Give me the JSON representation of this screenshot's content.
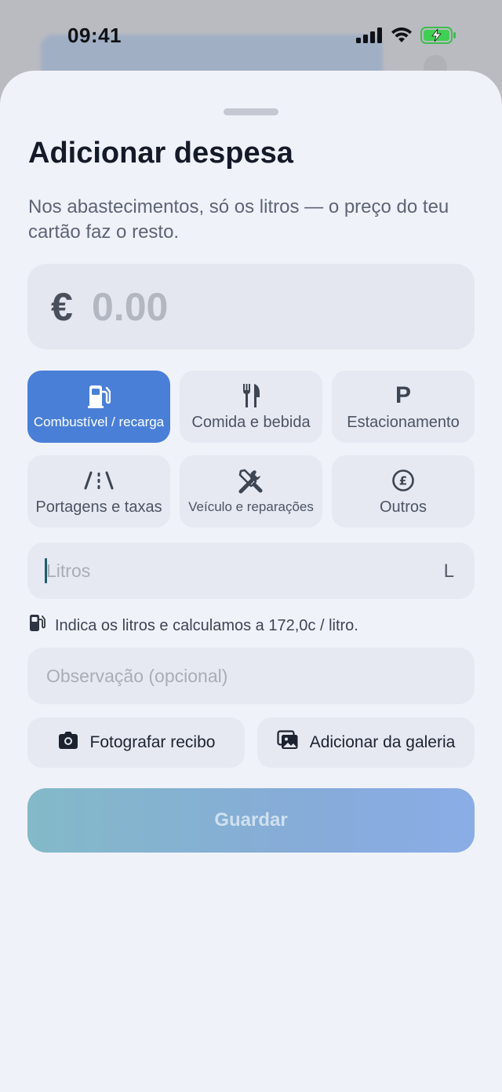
{
  "status": {
    "time": "09:41"
  },
  "sheet": {
    "title": "Adicionar despesa",
    "subtitle": "Nos abastecimentos, só os litros — o preço do teu cartão faz o resto."
  },
  "amount": {
    "currency": "€",
    "placeholder": "0.00"
  },
  "categories": [
    {
      "label": "Combustível / recarga",
      "icon": "fuel-pump-icon",
      "selected": true
    },
    {
      "label": "Comida e bebida",
      "icon": "fork-knife-icon",
      "selected": false
    },
    {
      "label": "Estacionamento",
      "icon": "parking-icon",
      "glyph": "P",
      "selected": false
    },
    {
      "label": "Portagens e taxas",
      "icon": "road-icon",
      "selected": false
    },
    {
      "label": "Veículo e reparações",
      "icon": "tools-icon",
      "selected": false
    },
    {
      "label": "Outros",
      "icon": "coin-icon",
      "selected": false
    }
  ],
  "liters": {
    "placeholder": "Litros",
    "unit": "L"
  },
  "hint": "Indica os litros e calculamos a 172,0c / litro.",
  "note": {
    "placeholder": "Observação (opcional)"
  },
  "actions": {
    "photo": "Fotografar recibo",
    "gallery": "Adicionar da galeria"
  },
  "save": {
    "label": "Guardar"
  },
  "colors": {
    "accent": "#4a7fd8",
    "sheet_bg": "#f0f2f9",
    "field_bg": "#e6e9f1"
  }
}
